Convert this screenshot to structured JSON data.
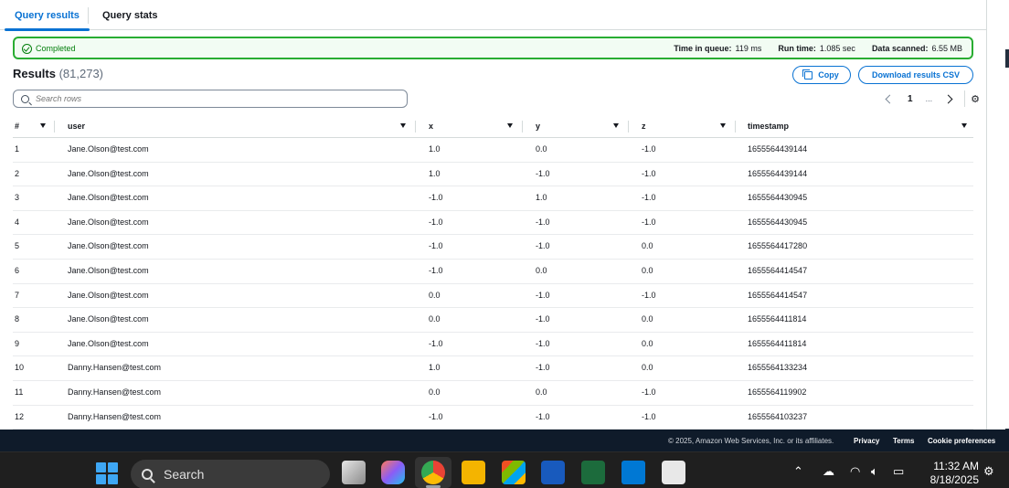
{
  "tabs": [
    {
      "label": "Query results",
      "active": true
    },
    {
      "label": "Query stats",
      "active": false
    }
  ],
  "status": {
    "text": "Completed",
    "color": "#037f0c",
    "time_in_queue_label": "Time in queue:",
    "time_in_queue": "119 ms",
    "run_time_label": "Run time:",
    "run_time": "1.085 sec",
    "data_scanned_label": "Data scanned:",
    "data_scanned": "6.55 MB"
  },
  "results": {
    "title": "Results",
    "count": "(81,273)",
    "copy_label": "Copy",
    "download_label": "Download results CSV",
    "search_placeholder": "Search rows",
    "current_page": "1",
    "ellipsis": "..."
  },
  "table": {
    "columns": [
      "#",
      "user",
      "x",
      "y",
      "z",
      "timestamp"
    ],
    "rows": [
      [
        "1",
        "Jane.Olson@test.com",
        "1.0",
        "0.0",
        "-1.0",
        "1655564439144"
      ],
      [
        "2",
        "Jane.Olson@test.com",
        "1.0",
        "-1.0",
        "-1.0",
        "1655564439144"
      ],
      [
        "3",
        "Jane.Olson@test.com",
        "-1.0",
        "1.0",
        "-1.0",
        "1655564430945"
      ],
      [
        "4",
        "Jane.Olson@test.com",
        "-1.0",
        "-1.0",
        "-1.0",
        "1655564430945"
      ],
      [
        "5",
        "Jane.Olson@test.com",
        "-1.0",
        "-1.0",
        "0.0",
        "1655564417280"
      ],
      [
        "6",
        "Jane.Olson@test.com",
        "-1.0",
        "0.0",
        "0.0",
        "1655564414547"
      ],
      [
        "7",
        "Jane.Olson@test.com",
        "0.0",
        "-1.0",
        "-1.0",
        "1655564414547"
      ],
      [
        "8",
        "Jane.Olson@test.com",
        "0.0",
        "-1.0",
        "0.0",
        "1655564411814"
      ],
      [
        "9",
        "Jane.Olson@test.com",
        "-1.0",
        "-1.0",
        "0.0",
        "1655564411814"
      ],
      [
        "10",
        "Danny.Hansen@test.com",
        "1.0",
        "-1.0",
        "0.0",
        "1655564133234"
      ],
      [
        "11",
        "Danny.Hansen@test.com",
        "0.0",
        "0.0",
        "-1.0",
        "1655564119902"
      ],
      [
        "12",
        "Danny.Hansen@test.com",
        "-1.0",
        "-1.0",
        "-1.0",
        "1655564103237"
      ]
    ]
  },
  "footer": {
    "copyright": "© 2025, Amazon Web Services, Inc. or its affiliates.",
    "privacy": "Privacy",
    "terms": "Terms",
    "cookies": "Cookie preferences"
  },
  "taskbar": {
    "search_label": "Search",
    "time": "11:32 AM",
    "date": "8/18/2025"
  }
}
